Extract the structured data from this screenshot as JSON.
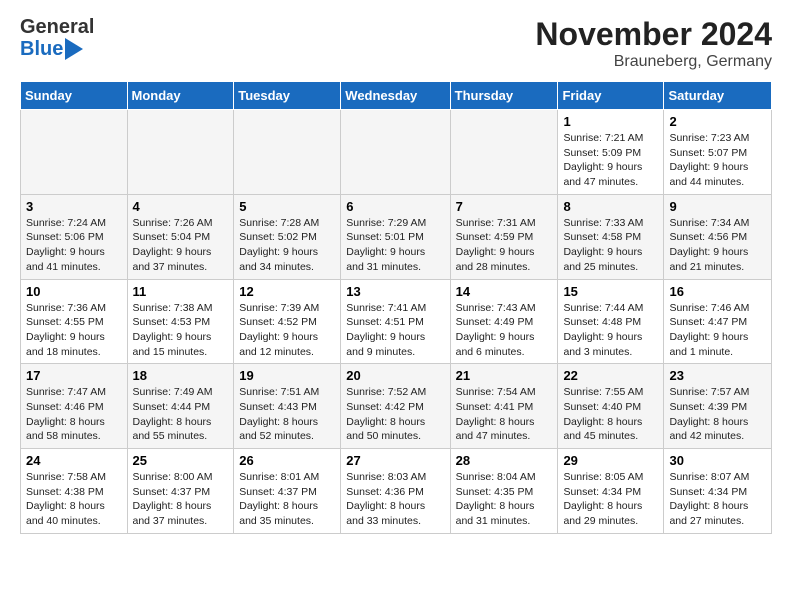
{
  "logo": {
    "general": "General",
    "blue": "Blue"
  },
  "header": {
    "month": "November 2024",
    "location": "Brauneberg, Germany"
  },
  "weekdays": [
    "Sunday",
    "Monday",
    "Tuesday",
    "Wednesday",
    "Thursday",
    "Friday",
    "Saturday"
  ],
  "weeks": [
    [
      {
        "day": "",
        "info": ""
      },
      {
        "day": "",
        "info": ""
      },
      {
        "day": "",
        "info": ""
      },
      {
        "day": "",
        "info": ""
      },
      {
        "day": "",
        "info": ""
      },
      {
        "day": "1",
        "info": "Sunrise: 7:21 AM\nSunset: 5:09 PM\nDaylight: 9 hours and 47 minutes."
      },
      {
        "day": "2",
        "info": "Sunrise: 7:23 AM\nSunset: 5:07 PM\nDaylight: 9 hours and 44 minutes."
      }
    ],
    [
      {
        "day": "3",
        "info": "Sunrise: 7:24 AM\nSunset: 5:06 PM\nDaylight: 9 hours and 41 minutes."
      },
      {
        "day": "4",
        "info": "Sunrise: 7:26 AM\nSunset: 5:04 PM\nDaylight: 9 hours and 37 minutes."
      },
      {
        "day": "5",
        "info": "Sunrise: 7:28 AM\nSunset: 5:02 PM\nDaylight: 9 hours and 34 minutes."
      },
      {
        "day": "6",
        "info": "Sunrise: 7:29 AM\nSunset: 5:01 PM\nDaylight: 9 hours and 31 minutes."
      },
      {
        "day": "7",
        "info": "Sunrise: 7:31 AM\nSunset: 4:59 PM\nDaylight: 9 hours and 28 minutes."
      },
      {
        "day": "8",
        "info": "Sunrise: 7:33 AM\nSunset: 4:58 PM\nDaylight: 9 hours and 25 minutes."
      },
      {
        "day": "9",
        "info": "Sunrise: 7:34 AM\nSunset: 4:56 PM\nDaylight: 9 hours and 21 minutes."
      }
    ],
    [
      {
        "day": "10",
        "info": "Sunrise: 7:36 AM\nSunset: 4:55 PM\nDaylight: 9 hours and 18 minutes."
      },
      {
        "day": "11",
        "info": "Sunrise: 7:38 AM\nSunset: 4:53 PM\nDaylight: 9 hours and 15 minutes."
      },
      {
        "day": "12",
        "info": "Sunrise: 7:39 AM\nSunset: 4:52 PM\nDaylight: 9 hours and 12 minutes."
      },
      {
        "day": "13",
        "info": "Sunrise: 7:41 AM\nSunset: 4:51 PM\nDaylight: 9 hours and 9 minutes."
      },
      {
        "day": "14",
        "info": "Sunrise: 7:43 AM\nSunset: 4:49 PM\nDaylight: 9 hours and 6 minutes."
      },
      {
        "day": "15",
        "info": "Sunrise: 7:44 AM\nSunset: 4:48 PM\nDaylight: 9 hours and 3 minutes."
      },
      {
        "day": "16",
        "info": "Sunrise: 7:46 AM\nSunset: 4:47 PM\nDaylight: 9 hours and 1 minute."
      }
    ],
    [
      {
        "day": "17",
        "info": "Sunrise: 7:47 AM\nSunset: 4:46 PM\nDaylight: 8 hours and 58 minutes."
      },
      {
        "day": "18",
        "info": "Sunrise: 7:49 AM\nSunset: 4:44 PM\nDaylight: 8 hours and 55 minutes."
      },
      {
        "day": "19",
        "info": "Sunrise: 7:51 AM\nSunset: 4:43 PM\nDaylight: 8 hours and 52 minutes."
      },
      {
        "day": "20",
        "info": "Sunrise: 7:52 AM\nSunset: 4:42 PM\nDaylight: 8 hours and 50 minutes."
      },
      {
        "day": "21",
        "info": "Sunrise: 7:54 AM\nSunset: 4:41 PM\nDaylight: 8 hours and 47 minutes."
      },
      {
        "day": "22",
        "info": "Sunrise: 7:55 AM\nSunset: 4:40 PM\nDaylight: 8 hours and 45 minutes."
      },
      {
        "day": "23",
        "info": "Sunrise: 7:57 AM\nSunset: 4:39 PM\nDaylight: 8 hours and 42 minutes."
      }
    ],
    [
      {
        "day": "24",
        "info": "Sunrise: 7:58 AM\nSunset: 4:38 PM\nDaylight: 8 hours and 40 minutes."
      },
      {
        "day": "25",
        "info": "Sunrise: 8:00 AM\nSunset: 4:37 PM\nDaylight: 8 hours and 37 minutes."
      },
      {
        "day": "26",
        "info": "Sunrise: 8:01 AM\nSunset: 4:37 PM\nDaylight: 8 hours and 35 minutes."
      },
      {
        "day": "27",
        "info": "Sunrise: 8:03 AM\nSunset: 4:36 PM\nDaylight: 8 hours and 33 minutes."
      },
      {
        "day": "28",
        "info": "Sunrise: 8:04 AM\nSunset: 4:35 PM\nDaylight: 8 hours and 31 minutes."
      },
      {
        "day": "29",
        "info": "Sunrise: 8:05 AM\nSunset: 4:34 PM\nDaylight: 8 hours and 29 minutes."
      },
      {
        "day": "30",
        "info": "Sunrise: 8:07 AM\nSunset: 4:34 PM\nDaylight: 8 hours and 27 minutes."
      }
    ]
  ]
}
